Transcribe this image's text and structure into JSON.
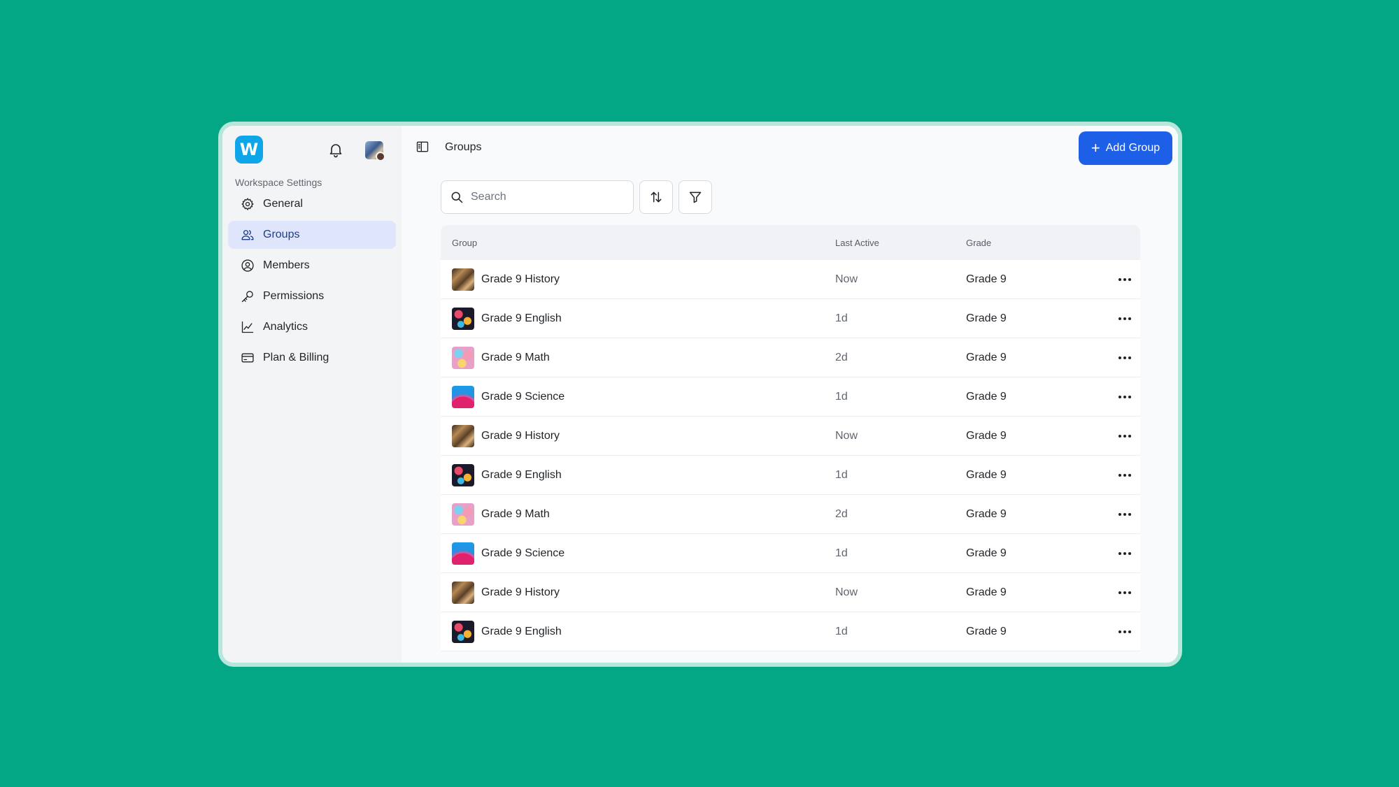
{
  "app": {
    "logo_letter": "W",
    "section_label": "Workspace Settings"
  },
  "sidebar": {
    "items": [
      {
        "label": "General",
        "icon": "gear-icon",
        "active": false
      },
      {
        "label": "Groups",
        "icon": "users-icon",
        "active": true
      },
      {
        "label": "Members",
        "icon": "user-circle-icon",
        "active": false
      },
      {
        "label": "Permissions",
        "icon": "key-icon",
        "active": false
      },
      {
        "label": "Analytics",
        "icon": "chart-line-icon",
        "active": false
      },
      {
        "label": "Plan & Billing",
        "icon": "credit-card-icon",
        "active": false
      }
    ]
  },
  "header": {
    "title": "Groups",
    "add_button_label": "Add Group"
  },
  "search": {
    "placeholder": "Search",
    "value": ""
  },
  "table": {
    "columns": [
      "Group",
      "Last Active",
      "Grade"
    ],
    "rows": [
      {
        "name": "Grade 9 History",
        "last_active": "Now",
        "grade": "Grade 9",
        "thumb": "history"
      },
      {
        "name": "Grade 9 English",
        "last_active": "1d",
        "grade": "Grade 9",
        "thumb": "english"
      },
      {
        "name": "Grade 9 Math",
        "last_active": "2d",
        "grade": "Grade 9",
        "thumb": "math"
      },
      {
        "name": "Grade 9 Science",
        "last_active": "1d",
        "grade": "Grade 9",
        "thumb": "science"
      },
      {
        "name": "Grade 9 History",
        "last_active": "Now",
        "grade": "Grade 9",
        "thumb": "history"
      },
      {
        "name": "Grade 9 English",
        "last_active": "1d",
        "grade": "Grade 9",
        "thumb": "english"
      },
      {
        "name": "Grade 9 Math",
        "last_active": "2d",
        "grade": "Grade 9",
        "thumb": "math"
      },
      {
        "name": "Grade 9 Science",
        "last_active": "1d",
        "grade": "Grade 9",
        "thumb": "science"
      },
      {
        "name": "Grade 9 History",
        "last_active": "Now",
        "grade": "Grade 9",
        "thumb": "history"
      },
      {
        "name": "Grade 9 English",
        "last_active": "1d",
        "grade": "Grade 9",
        "thumb": "english"
      }
    ]
  },
  "colors": {
    "background": "#04a785",
    "accent": "#1d5fe6",
    "active_nav": "#dfe6fb"
  }
}
